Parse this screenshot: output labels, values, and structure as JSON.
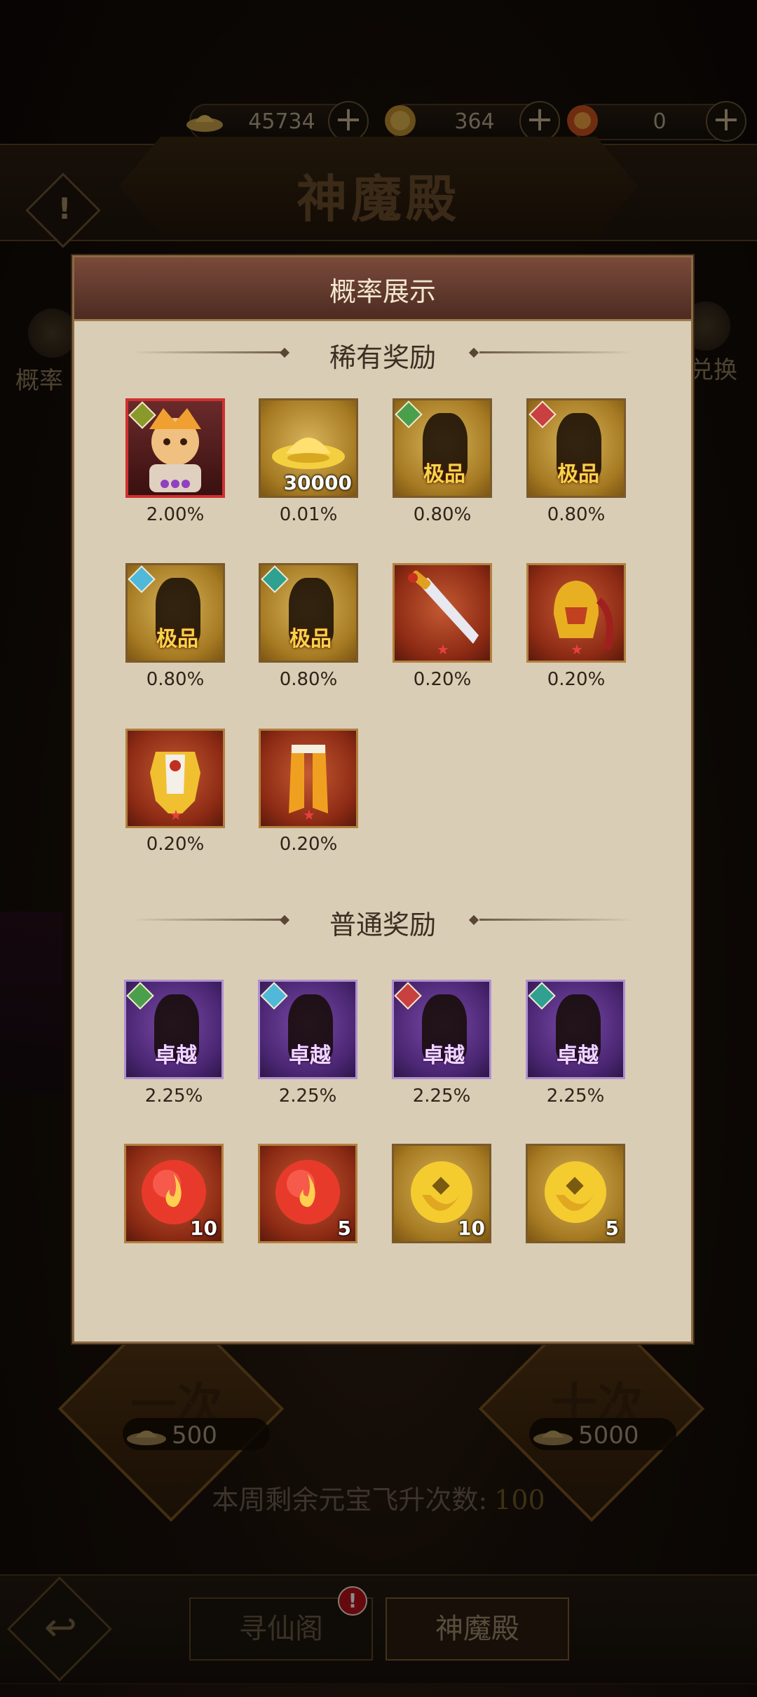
{
  "resources": [
    {
      "icon": "gold-ingot-icon",
      "value": "45734"
    },
    {
      "icon": "gold-coin-icon",
      "value": "364"
    },
    {
      "icon": "fire-orb-icon",
      "value": "0"
    }
  ],
  "page_title": "神魔殿",
  "side": {
    "left_label": "概率",
    "right_label": "兑换"
  },
  "summon": {
    "one": {
      "label": "一次",
      "cost": "500"
    },
    "ten": {
      "label": "十次",
      "cost": "5000"
    }
  },
  "weekly": {
    "label": "本周剩余元宝飞升次数:",
    "count": "100"
  },
  "nav": {
    "tab1": "寻仙阁",
    "tab2": "神魔殿",
    "alert": "!"
  },
  "modal": {
    "title": "概率展示",
    "rare_title": "稀有奖励",
    "rare_items": [
      {
        "type": "hero-avatar",
        "tag": "",
        "count": "",
        "prob": "2.00%"
      },
      {
        "type": "gold-ingot",
        "tag": "",
        "count": "30000",
        "prob": "0.01%"
      },
      {
        "type": "legendary-shard",
        "tag": "极品",
        "count": "",
        "prob": "0.80%"
      },
      {
        "type": "legendary-shard",
        "tag": "极品",
        "count": "",
        "prob": "0.80%"
      },
      {
        "type": "legendary-shard",
        "tag": "极品",
        "count": "",
        "prob": "0.80%"
      },
      {
        "type": "legendary-shard",
        "tag": "极品",
        "count": "",
        "prob": "0.80%"
      },
      {
        "type": "sword",
        "tag": "",
        "count": "",
        "prob": "0.20%"
      },
      {
        "type": "helmet",
        "tag": "",
        "count": "",
        "prob": "0.20%"
      },
      {
        "type": "armor",
        "tag": "",
        "count": "",
        "prob": "0.20%"
      },
      {
        "type": "boots",
        "tag": "",
        "count": "",
        "prob": "0.20%"
      }
    ],
    "common_title": "普通奖励",
    "common_items": [
      {
        "type": "epic-shard",
        "tag": "卓越",
        "count": "",
        "prob": "2.25%"
      },
      {
        "type": "epic-shard",
        "tag": "卓越",
        "count": "",
        "prob": "2.25%"
      },
      {
        "type": "epic-shard",
        "tag": "卓越",
        "count": "",
        "prob": "2.25%"
      },
      {
        "type": "epic-shard",
        "tag": "卓越",
        "count": "",
        "prob": "2.25%"
      },
      {
        "type": "fire-orb",
        "tag": "",
        "count": "10",
        "prob": ""
      },
      {
        "type": "fire-orb",
        "tag": "",
        "count": "5",
        "prob": ""
      },
      {
        "type": "jade-coin",
        "tag": "",
        "count": "10",
        "prob": ""
      },
      {
        "type": "jade-coin",
        "tag": "",
        "count": "5",
        "prob": ""
      }
    ]
  }
}
